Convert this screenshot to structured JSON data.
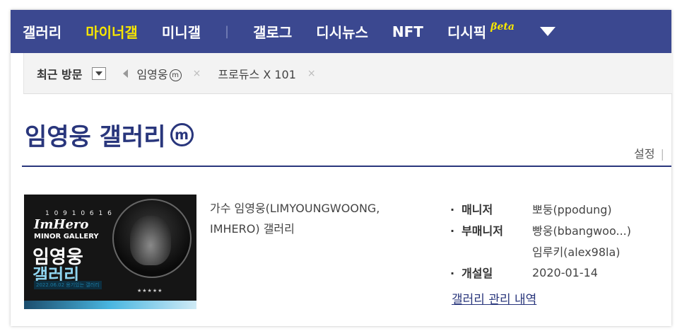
{
  "nav": {
    "items": [
      "갤러리",
      "마이너갤",
      "미니갤",
      "갤로그",
      "디시뉴스",
      "NFT",
      "디시픽"
    ],
    "highlighted_index": 1,
    "beta_label": "βeta",
    "more_icon": "caret-down-icon"
  },
  "recent": {
    "title": "최근 방문",
    "items": [
      {
        "label": "임영웅",
        "badge": "m"
      },
      {
        "label": "프로듀스 X 101",
        "badge": ""
      }
    ],
    "remove_glyph": "×"
  },
  "gallery": {
    "title": "임영웅 갤러리",
    "badge": "m",
    "settings_label": "설정",
    "description": "가수 임영웅(LIMYOUNGWOONG, IMHERO) 갤러리",
    "thumbnail": {
      "numbers": "1 0 9 1 0 6 1 6",
      "logo": "ImHero",
      "subtitle": "MINOR GALLERY",
      "name_line1": "임영웅",
      "name_line2": "갤러리",
      "date_caption": "2022.06.02 용기있는 갤러리",
      "stars": "★★★★★"
    },
    "info": [
      {
        "label": "매니저",
        "value": "뽀둥(ppodung)"
      },
      {
        "label": "부매니저",
        "value": "빵웅(bbangwoo...)"
      },
      {
        "label": "",
        "value": "임루키(alex98la)"
      },
      {
        "label": "개설일",
        "value": "2020-01-14"
      }
    ],
    "mgmt_link": "갤러리 관리 내역"
  },
  "colors": {
    "nav_bg": "#3b4890",
    "highlight": "#f7e600",
    "title": "#29367c"
  }
}
